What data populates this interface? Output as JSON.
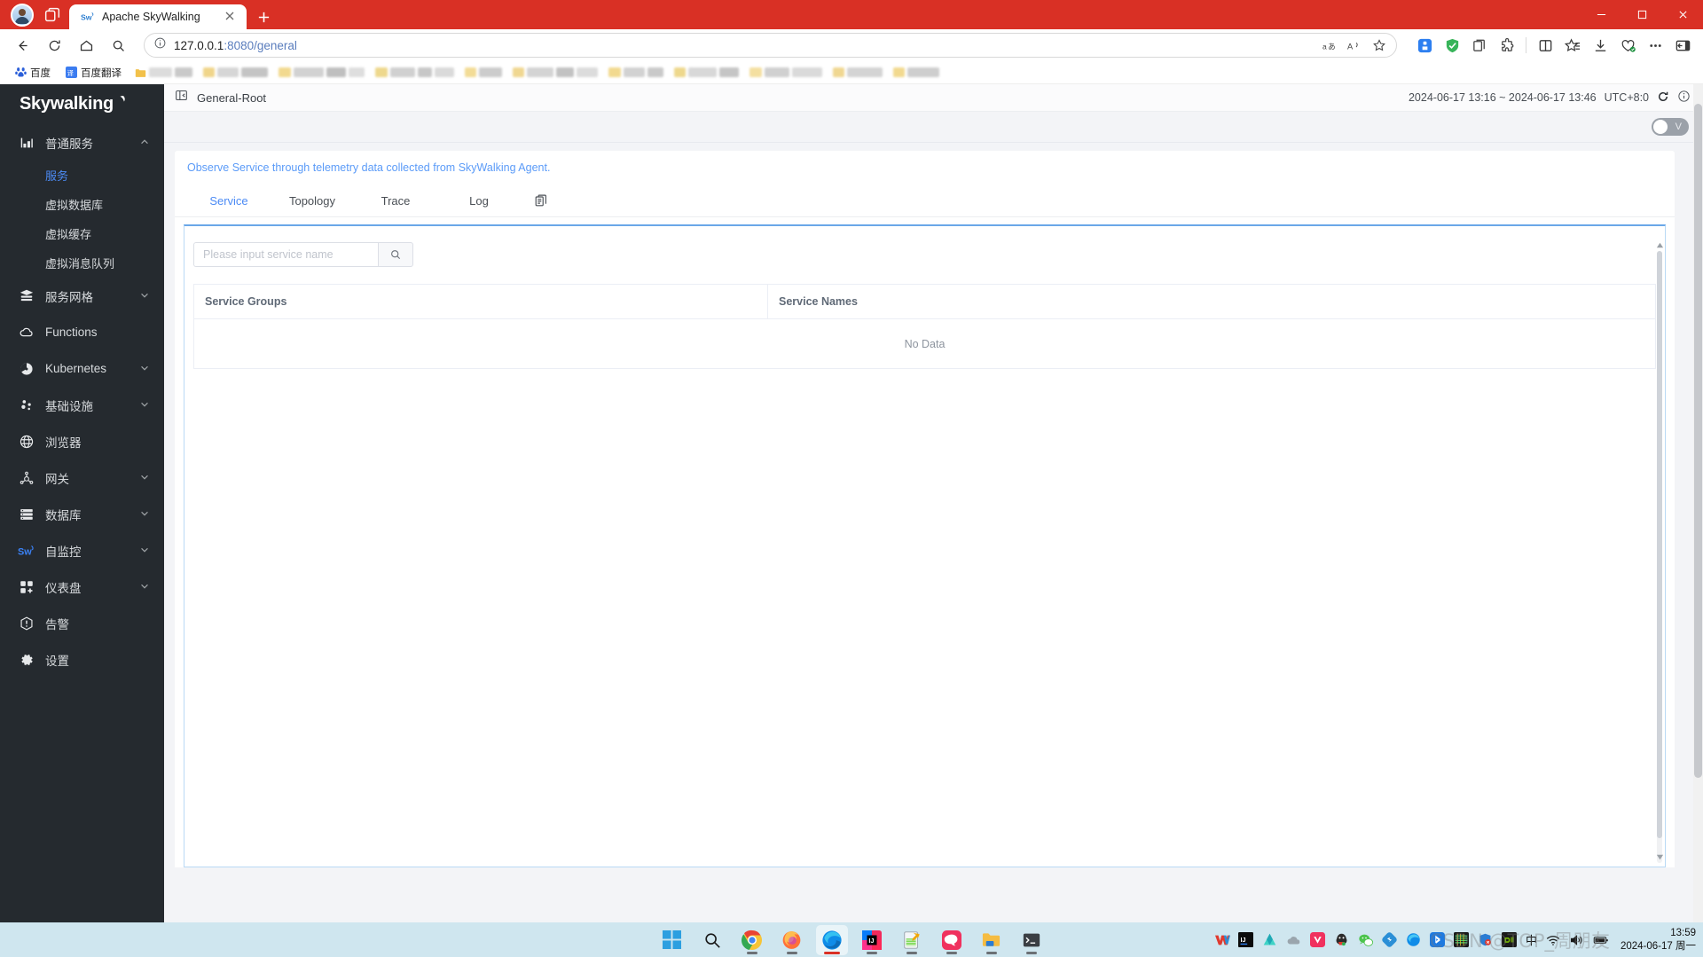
{
  "browser": {
    "tab": {
      "title": "Apache SkyWalking",
      "favicon": "skywalking-favicon"
    },
    "newtab_label": "+",
    "window_controls": {
      "minimize": "─",
      "maximize": "□",
      "close": "✕"
    },
    "omnibox": {
      "url_host": "127.0.0.1",
      "url_rest": ":8080/general",
      "info_icon": "info-icon"
    },
    "bookmarks": [
      {
        "label": "百度",
        "icon": "baidu-icon"
      },
      {
        "label": "百度翻译",
        "icon": "baidu-translate-icon"
      }
    ]
  },
  "sidebar": {
    "logo": {
      "text_sky": "Sky",
      "text_walking": "walking"
    },
    "items": [
      {
        "label": "普通服务",
        "icon": "chart-bar-icon",
        "expanded": true,
        "chevron": "chevron-up-icon"
      },
      {
        "label": "服务网格",
        "icon": "mesh-icon",
        "expanded": false,
        "chevron": "chevron-down-icon"
      },
      {
        "label": "Functions",
        "icon": "cloud-icon",
        "expanded": null,
        "chevron": ""
      },
      {
        "label": "Kubernetes",
        "icon": "kubernetes-icon",
        "expanded": false,
        "chevron": "chevron-down-icon"
      },
      {
        "label": "基础设施",
        "icon": "infrastructure-icon",
        "expanded": false,
        "chevron": "chevron-down-icon"
      },
      {
        "label": "浏览器",
        "icon": "globe-icon",
        "expanded": null,
        "chevron": ""
      },
      {
        "label": "网关",
        "icon": "gateway-icon",
        "expanded": false,
        "chevron": "chevron-down-icon"
      },
      {
        "label": "数据库",
        "icon": "database-icon",
        "expanded": false,
        "chevron": "chevron-down-icon"
      },
      {
        "label": "自监控",
        "icon": "skywalking-sw-icon",
        "expanded": false,
        "chevron": "chevron-down-icon"
      },
      {
        "label": "仪表盘",
        "icon": "dashboard-grid-icon",
        "expanded": false,
        "chevron": "chevron-down-icon"
      },
      {
        "label": "告警",
        "icon": "alarm-icon",
        "expanded": null,
        "chevron": ""
      },
      {
        "label": "设置",
        "icon": "settings-gear-icon",
        "expanded": null,
        "chevron": ""
      }
    ],
    "sub_items": [
      {
        "label": "服务",
        "active": true
      },
      {
        "label": "虚拟数据库",
        "active": false
      },
      {
        "label": "虚拟缓存",
        "active": false
      },
      {
        "label": "虚拟消息队列",
        "active": false
      }
    ]
  },
  "topbar": {
    "collapse_icon": "collapse-sidebar-icon",
    "title": "General-Root",
    "time_range": "2024-06-17 13:16 ~ 2024-06-17 13:46",
    "timezone": "UTC+8:0",
    "reload_icon": "reload-icon",
    "info_icon": "info-circle-icon"
  },
  "subbar": {
    "toggle_label": "V",
    "toggle_on": false
  },
  "main": {
    "notice": "Observe Service through telemetry data collected from SkyWalking Agent.",
    "tabs": [
      {
        "label": "Service",
        "active": true
      },
      {
        "label": "Topology",
        "active": false
      },
      {
        "label": "Trace",
        "active": false
      },
      {
        "label": "Log",
        "active": false
      }
    ],
    "tabs_extra_icon": "copy-icon",
    "search": {
      "placeholder": "Please input service name",
      "value": "",
      "button_icon": "search-icon"
    },
    "table": {
      "columns": [
        "Service Groups",
        "Service Names"
      ],
      "rows": [],
      "empty_text": "No Data"
    }
  },
  "taskbar": {
    "apps": [
      {
        "name": "start-windows-icon",
        "active": false,
        "running": false
      },
      {
        "name": "search-taskbar-icon",
        "active": false,
        "running": false
      },
      {
        "name": "google-chrome-icon",
        "active": false,
        "running": true
      },
      {
        "name": "firefox-icon",
        "active": false,
        "running": true
      },
      {
        "name": "microsoft-edge-icon",
        "active": true,
        "running": true
      },
      {
        "name": "intellij-idea-icon",
        "active": false,
        "running": true
      },
      {
        "name": "notepad-editor-icon",
        "active": false,
        "running": true
      },
      {
        "name": "navicat-icon",
        "active": false,
        "running": true
      },
      {
        "name": "file-explorer-icon",
        "active": false,
        "running": true
      },
      {
        "name": "terminal-icon",
        "active": false,
        "running": true
      }
    ],
    "tray": [
      "onedrive-cloud-icon",
      "vmware-icon",
      "intellij-tray-icon",
      "affinity-icon",
      "cloud-icon",
      "v2ray-icon",
      "qq-icon",
      "wechat-icon",
      "ding-icon",
      "edge-dev-icon",
      "bluetooth-icon",
      "monitor-stats-icon",
      "security-shield-icon",
      "nvidia-icon"
    ],
    "ime": "中",
    "network_icon": "wifi-icon",
    "volume_icon": "volume-icon",
    "battery_icon": "battery-icon",
    "clock_time": "13:59",
    "clock_date": "2024-06-17 周一",
    "watermark": "CSDN @TOP_周朋友"
  }
}
